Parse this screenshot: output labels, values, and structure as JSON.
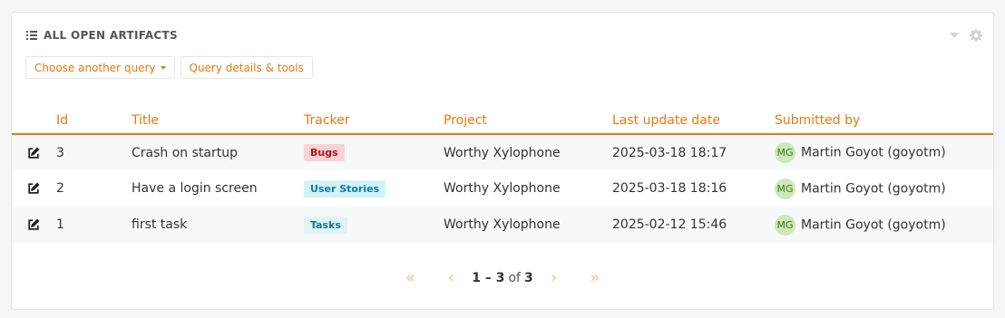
{
  "widget": {
    "title": "ALL OPEN ARTIFACTS",
    "buttons": {
      "choose_query": "Choose another query",
      "query_details": "Query details & tools"
    }
  },
  "table": {
    "columns": [
      "Id",
      "Title",
      "Tracker",
      "Project",
      "Last update date",
      "Submitted by"
    ],
    "rows": [
      {
        "id": "3",
        "title": "Crash on startup",
        "tracker": "Bugs",
        "project": "Worthy Xylophone",
        "date": "2025-03-18 18:17",
        "avatar": "MG",
        "submitter": "Martin Goyot (goyotm)"
      },
      {
        "id": "2",
        "title": "Have a login screen",
        "tracker": "User Stories",
        "project": "Worthy Xylophone",
        "date": "2025-03-18 18:16",
        "avatar": "MG",
        "submitter": "Martin Goyot (goyotm)"
      },
      {
        "id": "1",
        "title": "first task",
        "tracker": "Tasks",
        "project": "Worthy Xylophone",
        "date": "2025-02-12 15:46",
        "avatar": "MG",
        "submitter": "Martin Goyot (goyotm)"
      }
    ]
  },
  "pagination": {
    "range": "1 – 3",
    "of": "of",
    "total": "3"
  },
  "colors": {
    "accent": "#e8790f",
    "bugs_bg": "#f8d2d4",
    "bugs_fg": "#b0121f",
    "stories_bg": "#d4f1f9",
    "stories_fg": "#0c7fa3",
    "tasks_bg": "#e0f3f6",
    "tasks_fg": "#117888"
  }
}
